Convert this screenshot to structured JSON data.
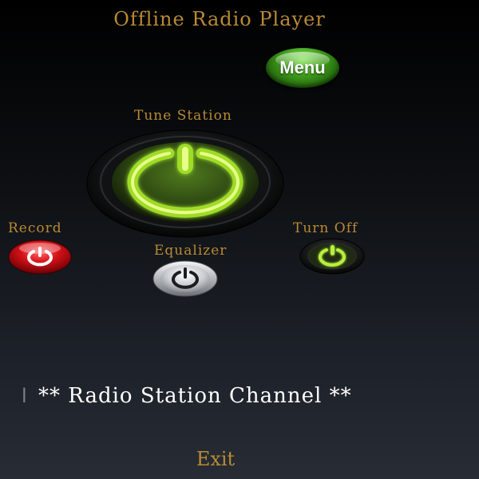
{
  "app": {
    "title": "Offline Radio Player"
  },
  "header": {
    "menu_label": "Menu"
  },
  "controls": {
    "tune_label": "Tune Station",
    "record_label": "Record",
    "turn_off_label": "Turn Off",
    "equalizer_label": "Equalizer"
  },
  "station": {
    "cursor": "l",
    "text": "** Radio Station Channel **"
  },
  "footer": {
    "exit_label": "Exit"
  },
  "icons": {
    "tune": "power-icon",
    "record": "power-icon",
    "turn_off": "power-icon",
    "equalizer": "power-icon"
  },
  "colors": {
    "accent_gold": "#b98a35",
    "menu_green": "#3f9c1c",
    "glow_green": "#b7f03c",
    "record_red": "#d8121a",
    "silver": "#c9ccd1",
    "text_white": "#ffffff"
  }
}
